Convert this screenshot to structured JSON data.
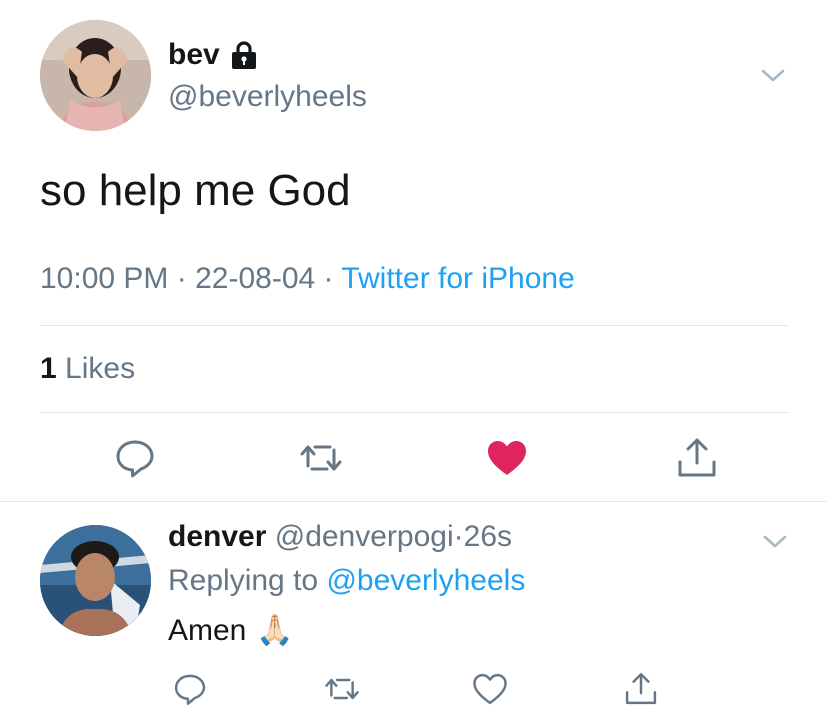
{
  "tweet": {
    "display_name": "bev",
    "handle": "@beverlyheels",
    "text": "so help me God",
    "time": "10:00 PM",
    "date": "22-08-04",
    "source": "Twitter for iPhone",
    "separator": "·",
    "likes_count": "1",
    "likes_label": "Likes",
    "liked": true
  },
  "reply": {
    "display_name": "denver",
    "handle": "@denverpogi",
    "separator": "·",
    "age": "26s",
    "replying_prefix": "Replying to",
    "replying_to": "@beverlyheels",
    "text": "Amen",
    "emoji": "🙏🏻"
  },
  "icons": {
    "lock": "lock-icon",
    "caret": "chevron-down-icon",
    "reply": "reply-icon",
    "retweet": "retweet-icon",
    "like": "heart-icon",
    "share": "share-icon"
  },
  "colors": {
    "accent": "#1da1f2",
    "like": "#e0245e",
    "secondary_text": "#657786",
    "divider": "#e1e8ed"
  }
}
